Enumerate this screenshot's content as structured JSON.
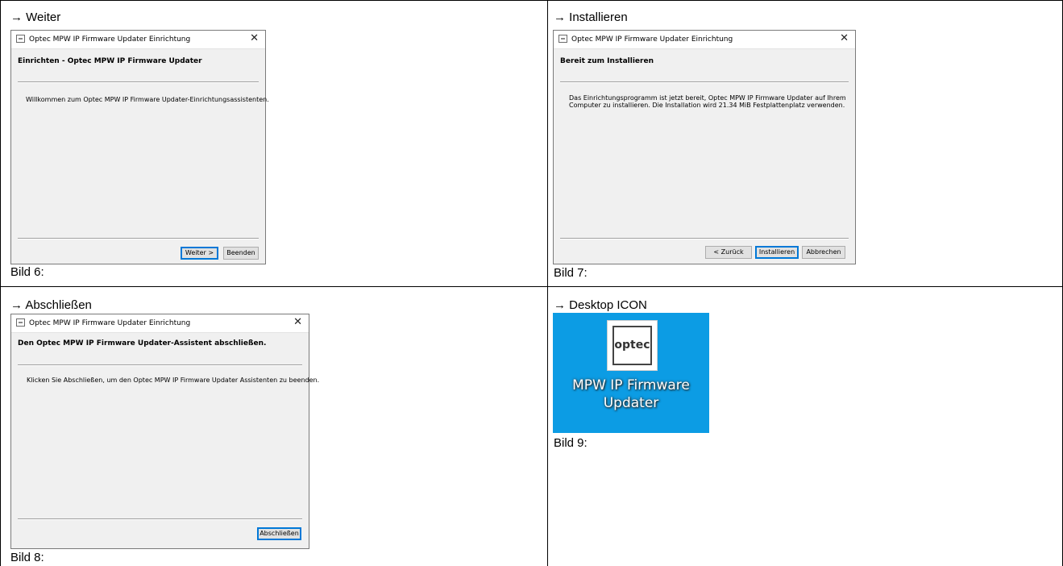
{
  "cells": [
    {
      "heading": "→ Weiter",
      "caption": "Bild 6:"
    },
    {
      "heading": "→ Installieren",
      "caption": "Bild 7:"
    },
    {
      "heading": "→ Abschließen",
      "caption": "Bild 8:"
    },
    {
      "heading": "→ Desktop ICON",
      "caption": "Bild 9:"
    }
  ],
  "dialog_title": "Optec MPW IP Firmware Updater Einrichtung",
  "close_glyph": "✕",
  "dialog6": {
    "heading": "Einrichten - Optec MPW IP Firmware Updater",
    "body": "Willkommen zum Optec MPW IP Firmware Updater-Einrichtungsassistenten.",
    "next_label": "Weiter >",
    "quit_label": "Beenden"
  },
  "dialog7": {
    "heading": "Bereit zum Installieren",
    "body_line1": "Das Einrichtungsprogramm ist jetzt bereit, Optec MPW IP Firmware Updater auf Ihrem",
    "body_line2": "Computer zu installieren. Die Installation wird 21.34 MiB Festplattenplatz verwenden.",
    "back_label": "< Zurück",
    "install_label": "Installieren",
    "cancel_label": "Abbrechen"
  },
  "dialog8": {
    "heading": "Den Optec MPW IP Firmware Updater-Assistent abschließen.",
    "body": "Klicken Sie Abschließen, um den Optec MPW IP Firmware Updater Assistenten zu beenden.",
    "finish_label": "Abschließen"
  },
  "desktop_icon": {
    "logo_text": "optec",
    "label_line1": "MPW IP Firmware",
    "label_line2": "Updater",
    "background_color": "#0c9ce4"
  }
}
